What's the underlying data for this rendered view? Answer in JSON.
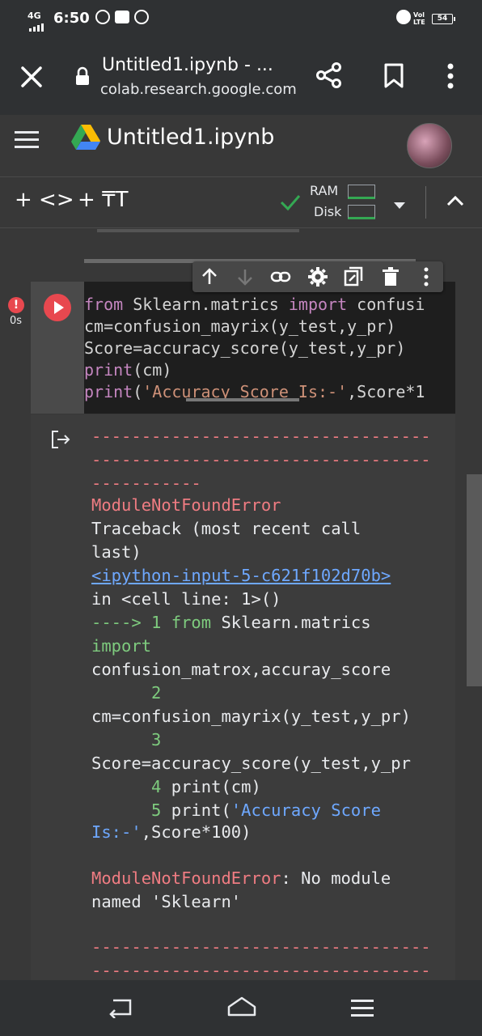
{
  "status_bar": {
    "network": "4G",
    "time": "6:50",
    "signal_label": "Vol LTE",
    "battery": "54"
  },
  "browser": {
    "page_title": "Untitled1.ipynb - ...",
    "url": "colab.research.google.com",
    "icons": [
      "close-icon",
      "lock-icon",
      "share-icon",
      "bookmark-icon",
      "more-vert-icon"
    ]
  },
  "colab": {
    "notebook_title": "Untitled1.ipynb",
    "toolbar": {
      "add_code": "+ <>",
      "add_text": "+ ₸T",
      "ram_label": "RAM",
      "disk_label": "Disk"
    }
  },
  "cell": {
    "exec_time": "0s",
    "code_lines": [
      {
        "kw": "from",
        "rest": " Sklearn.matrics ",
        "kw2": "import",
        "tail": " confusi"
      },
      {
        "plain": "cm=confusion_mayrix(y_test,y_pr)"
      },
      {
        "plain": "Score=accuracy_score(y_test,y_pr)"
      },
      {
        "kw": "print",
        "rest": "(cm)"
      },
      {
        "kw": "print",
        "rest": "(",
        "str": "'Accuracy Score Is:-'",
        "tail": ",Score*1"
      }
    ]
  },
  "output": {
    "dashes1": "----------------------------------",
    "dashes2": "----------------------------------",
    "dashes3": "-----------",
    "error_name": "ModuleNotFoundError",
    "traceback_1": "Traceback (most recent call",
    "traceback_2": "last)",
    "link": "<ipython-input-5-c621f102d70b>",
    "in_cell": "in <cell line: 1>()",
    "arrow_line": "----> 1 ",
    "arrow_from": "from",
    "arrow_rest": " Sklearn.matrics",
    "import_kw": "import",
    "import_line": "confusion_matrox,accuray_score",
    "ln2": "      2",
    "line2": "cm=confusion_mayrix(y_test,y_pr)",
    "ln3": "      3",
    "line3": "Score=accuracy_score(y_test,y_pr",
    "ln4": "      4",
    "line4": " print(cm)",
    "ln5": "      5",
    "line5a": " print(",
    "line5b": "'Accuracy Score",
    "line6a": "Is:-'",
    "line6b": ",Score*100)",
    "final_error_name": "ModuleNotFoundError",
    "final_msg": ": No module",
    "final_msg2": "named 'Sklearn'",
    "dashes4": "----------------------------------",
    "dashes5": "----------------------------------"
  }
}
